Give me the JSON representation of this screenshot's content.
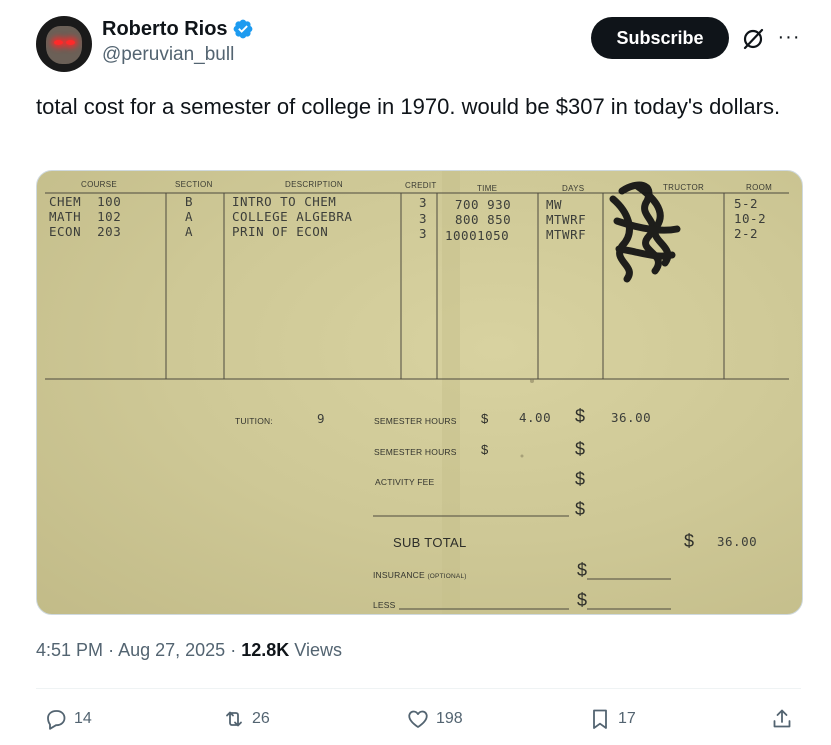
{
  "author": {
    "display_name": "Roberto Rios",
    "handle": "@peruvian_bull",
    "verified_icon": "verified-badge-icon",
    "avatar_icon": "avatar-bull-glowing-eyes"
  },
  "header": {
    "subscribe_label": "Subscribe",
    "more_label": "···"
  },
  "tweet": {
    "text": "total cost for a semester of college in 1970. would be $307 in today's dollars."
  },
  "receipt": {
    "headers": {
      "course": "COURSE",
      "section": "SECTION",
      "description": "DESCRIPTION",
      "credit": "CREDIT",
      "time": "TIME",
      "days": "DAYS",
      "instructor": "TRUCTOR",
      "room": "ROOM"
    },
    "rows": [
      {
        "course": "CHEM  100",
        "section": "B",
        "description": "INTRO TO CHEM",
        "credit": "3",
        "time": "700 930",
        "days": "MW",
        "room": "5-2"
      },
      {
        "course": "MATH  102",
        "section": "A",
        "description": "COLLEGE ALGEBRA",
        "credit": "3",
        "time": "800 850",
        "days": "MTWRF",
        "room": "10-2"
      },
      {
        "course": "ECON  203",
        "section": "A",
        "description": "PRIN OF ECON",
        "credit": "3",
        "time": "10001050",
        "days": "MTWRF",
        "room": "2-2"
      }
    ],
    "tuition_label": "TUITION:",
    "tuition_hours": "9",
    "semester_hours_label": "SEMESTER HOURS",
    "semester_hours_label_2": "SEMESTER HOURS",
    "activity_fee_label": "ACTIVITY FEE",
    "rate": "4.00",
    "tuition_total": "36.00",
    "subtotal_label": "SUB TOTAL",
    "subtotal_value": "36.00",
    "insurance_label": "INSURANCE",
    "insurance_note": "(OPTIONAL)",
    "less_label": "LESS",
    "dollar_sign": "$"
  },
  "meta": {
    "time": "4:51 PM",
    "separator": "·",
    "date": "Aug 27, 2025",
    "views_count": "12.8K",
    "views_label": "Views"
  },
  "actions": {
    "replies": "14",
    "reposts": "26",
    "likes": "198",
    "bookmarks": "17"
  },
  "colors": {
    "subscribe_bg": "#0f1419",
    "verified": "#1d9bf0",
    "muted": "#536471",
    "paper": "#cec896"
  }
}
